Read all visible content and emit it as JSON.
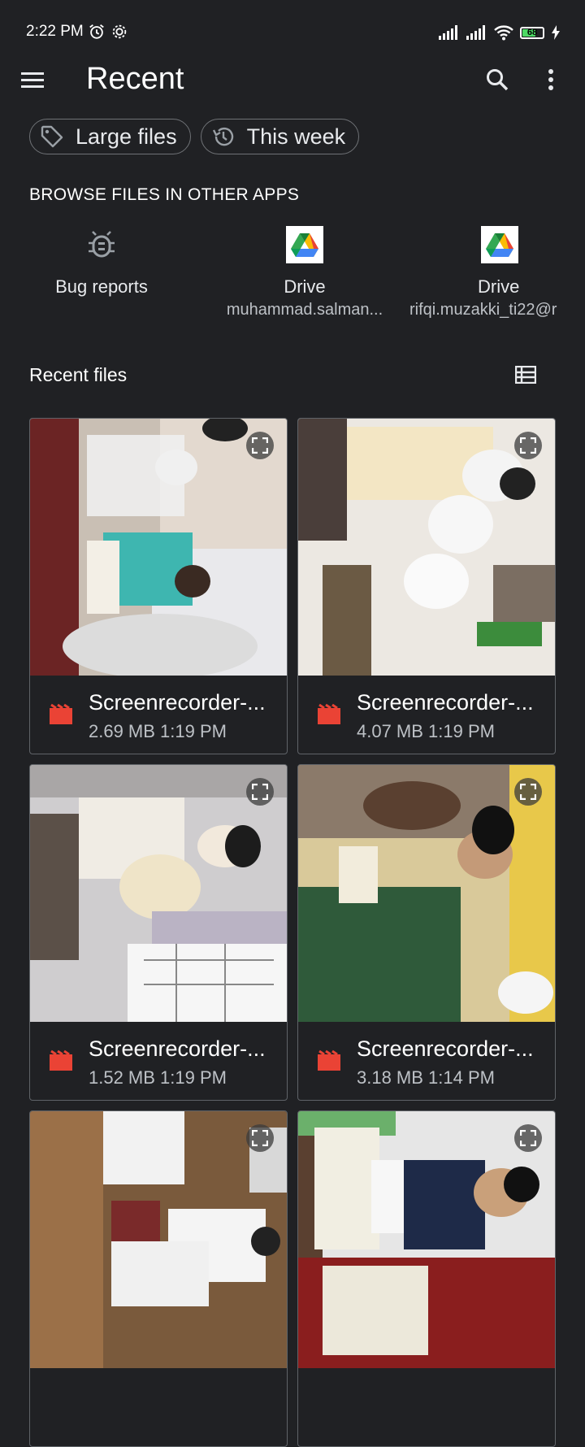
{
  "status": {
    "time": "2:22 PM",
    "battery": "68",
    "battery_level": 0.68,
    "icons": [
      "alarm-icon",
      "settings-icon",
      "signal-icon",
      "signal-icon",
      "wifi-icon",
      "battery-icon",
      "charging-icon"
    ]
  },
  "appbar": {
    "title": "Recent",
    "icons": [
      "menu-icon",
      "search-icon",
      "more-vert-icon"
    ]
  },
  "chips": [
    {
      "label": "Large files",
      "icon": "tag-icon"
    },
    {
      "label": "This week",
      "icon": "history-icon"
    }
  ],
  "browse": {
    "heading": "BROWSE FILES IN OTHER APPS",
    "apps": [
      {
        "name": "Bug reports",
        "sub": "",
        "icon": "bug-icon"
      },
      {
        "name": "Drive",
        "sub": "muhammad.salman...",
        "icon": "google-drive-icon"
      },
      {
        "name": "Drive",
        "sub": "rifqi.muzakki_ti22@r",
        "icon": "google-drive-icon"
      }
    ]
  },
  "recent": {
    "heading": "Recent files",
    "view_icon": "list-view-icon",
    "files": [
      {
        "name": "Screenrecorder-...",
        "meta": "2.69 MB 1:19 PM",
        "icon": "video-icon"
      },
      {
        "name": "Screenrecorder-...",
        "meta": "4.07 MB 1:19 PM",
        "icon": "video-icon"
      },
      {
        "name": "Screenrecorder-...",
        "meta": "1.52 MB 1:19 PM",
        "icon": "video-icon"
      },
      {
        "name": "Screenrecorder-...",
        "meta": "3.18 MB 1:14 PM",
        "icon": "video-icon"
      },
      {
        "name": "",
        "meta": "",
        "icon": "video-icon"
      },
      {
        "name": "",
        "meta": "",
        "icon": "video-icon"
      }
    ]
  },
  "colors": {
    "background": "#202124",
    "video_icon": "#ea4335",
    "chip_border": "#6f7276",
    "battery_fill": "#4cd964"
  }
}
